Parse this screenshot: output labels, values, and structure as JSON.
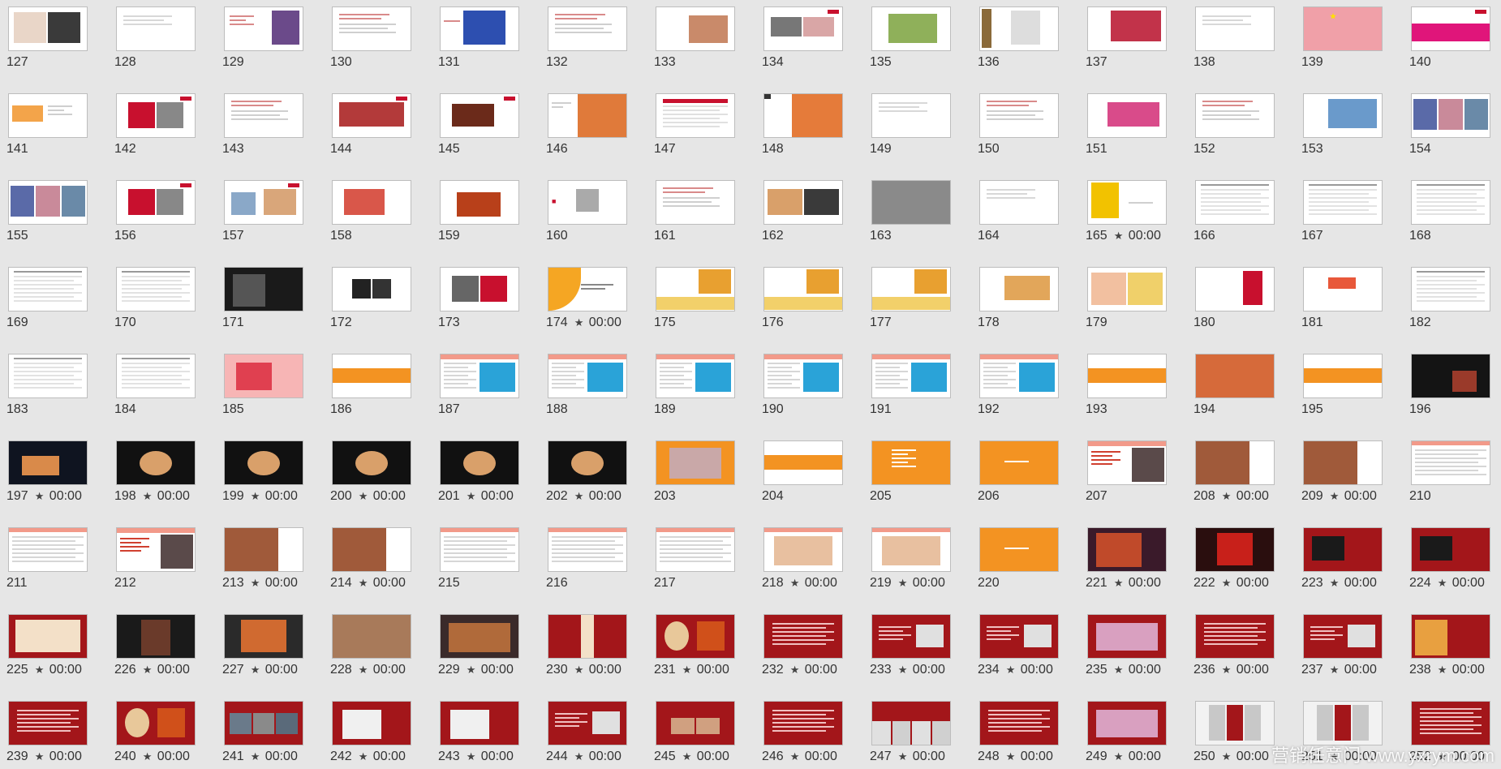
{
  "slides": [
    {
      "n": "127",
      "t": "",
      "s": "w1"
    },
    {
      "n": "128",
      "t": "",
      "s": "w0"
    },
    {
      "n": "129",
      "t": "",
      "s": "w4"
    },
    {
      "n": "130",
      "t": "",
      "s": "w2"
    },
    {
      "n": "131",
      "t": "",
      "s": "w5"
    },
    {
      "n": "132",
      "t": "",
      "s": "w2"
    },
    {
      "n": "133",
      "t": "",
      "s": "w6"
    },
    {
      "n": "134",
      "t": "",
      "s": "w3"
    },
    {
      "n": "135",
      "t": "",
      "s": "w7"
    },
    {
      "n": "136",
      "t": "",
      "s": "w8"
    },
    {
      "n": "137",
      "t": "",
      "s": "w9"
    },
    {
      "n": "138",
      "t": "",
      "s": "w0"
    },
    {
      "n": "139",
      "t": "",
      "s": "w10"
    },
    {
      "n": "140",
      "t": "",
      "s": "w11"
    },
    {
      "n": "141",
      "t": "",
      "s": "w12"
    },
    {
      "n": "142",
      "t": "",
      "s": "w13"
    },
    {
      "n": "143",
      "t": "",
      "s": "w2"
    },
    {
      "n": "144",
      "t": "",
      "s": "w14"
    },
    {
      "n": "145",
      "t": "",
      "s": "w15"
    },
    {
      "n": "146",
      "t": "",
      "s": "w16"
    },
    {
      "n": "147",
      "t": "",
      "s": "w17"
    },
    {
      "n": "148",
      "t": "",
      "s": "w18"
    },
    {
      "n": "149",
      "t": "",
      "s": "w0"
    },
    {
      "n": "150",
      "t": "",
      "s": "w2"
    },
    {
      "n": "151",
      "t": "",
      "s": "w19"
    },
    {
      "n": "152",
      "t": "",
      "s": "w2"
    },
    {
      "n": "153",
      "t": "",
      "s": "w20"
    },
    {
      "n": "154",
      "t": "",
      "s": "w21"
    },
    {
      "n": "155",
      "t": "",
      "s": "w21"
    },
    {
      "n": "156",
      "t": "",
      "s": "w13"
    },
    {
      "n": "157",
      "t": "",
      "s": "w22"
    },
    {
      "n": "158",
      "t": "",
      "s": "w23"
    },
    {
      "n": "159",
      "t": "",
      "s": "w24"
    },
    {
      "n": "160",
      "t": "",
      "s": "w25"
    },
    {
      "n": "161",
      "t": "",
      "s": "w2"
    },
    {
      "n": "162",
      "t": "",
      "s": "w26"
    },
    {
      "n": "163",
      "t": "",
      "s": "w27"
    },
    {
      "n": "164",
      "t": "",
      "s": "w0"
    },
    {
      "n": "165",
      "t": "00:00",
      "s": "w28"
    },
    {
      "n": "166",
      "t": "",
      "s": "w29"
    },
    {
      "n": "167",
      "t": "",
      "s": "w29"
    },
    {
      "n": "168",
      "t": "",
      "s": "w29"
    },
    {
      "n": "169",
      "t": "",
      "s": "w29"
    },
    {
      "n": "170",
      "t": "",
      "s": "w29"
    },
    {
      "n": "171",
      "t": "",
      "s": "d1"
    },
    {
      "n": "172",
      "t": "",
      "s": "w30"
    },
    {
      "n": "173",
      "t": "",
      "s": "w31"
    },
    {
      "n": "174",
      "t": "00:00",
      "s": "w32"
    },
    {
      "n": "175",
      "t": "",
      "s": "w33"
    },
    {
      "n": "176",
      "t": "",
      "s": "w33"
    },
    {
      "n": "177",
      "t": "",
      "s": "w33"
    },
    {
      "n": "178",
      "t": "",
      "s": "w34"
    },
    {
      "n": "179",
      "t": "",
      "s": "w35"
    },
    {
      "n": "180",
      "t": "",
      "s": "w36"
    },
    {
      "n": "181",
      "t": "",
      "s": "w37"
    },
    {
      "n": "182",
      "t": "",
      "s": "w29"
    },
    {
      "n": "183",
      "t": "",
      "s": "w29"
    },
    {
      "n": "184",
      "t": "",
      "s": "w29"
    },
    {
      "n": "185",
      "t": "",
      "s": "w38"
    },
    {
      "n": "186",
      "t": "",
      "s": "o1"
    },
    {
      "n": "187",
      "t": "",
      "s": "w39"
    },
    {
      "n": "188",
      "t": "",
      "s": "w39"
    },
    {
      "n": "189",
      "t": "",
      "s": "w39"
    },
    {
      "n": "190",
      "t": "",
      "s": "w39"
    },
    {
      "n": "191",
      "t": "",
      "s": "w39"
    },
    {
      "n": "192",
      "t": "",
      "s": "w39"
    },
    {
      "n": "193",
      "t": "",
      "s": "o1"
    },
    {
      "n": "194",
      "t": "",
      "s": "w40"
    },
    {
      "n": "195",
      "t": "",
      "s": "o1"
    },
    {
      "n": "196",
      "t": "",
      "s": "d2"
    },
    {
      "n": "197",
      "t": "00:00",
      "s": "d3"
    },
    {
      "n": "198",
      "t": "00:00",
      "s": "d4"
    },
    {
      "n": "199",
      "t": "00:00",
      "s": "d4"
    },
    {
      "n": "200",
      "t": "00:00",
      "s": "d4"
    },
    {
      "n": "201",
      "t": "00:00",
      "s": "d4"
    },
    {
      "n": "202",
      "t": "00:00",
      "s": "d4"
    },
    {
      "n": "203",
      "t": "",
      "s": "o2"
    },
    {
      "n": "204",
      "t": "",
      "s": "o1"
    },
    {
      "n": "205",
      "t": "",
      "s": "o3"
    },
    {
      "n": "206",
      "t": "",
      "s": "o4"
    },
    {
      "n": "207",
      "t": "",
      "s": "w41"
    },
    {
      "n": "208",
      "t": "00:00",
      "s": "w42"
    },
    {
      "n": "209",
      "t": "00:00",
      "s": "w42"
    },
    {
      "n": "210",
      "t": "",
      "s": "w43"
    },
    {
      "n": "211",
      "t": "",
      "s": "w43"
    },
    {
      "n": "212",
      "t": "",
      "s": "w41"
    },
    {
      "n": "213",
      "t": "00:00",
      "s": "w42"
    },
    {
      "n": "214",
      "t": "00:00",
      "s": "w42"
    },
    {
      "n": "215",
      "t": "",
      "s": "w43"
    },
    {
      "n": "216",
      "t": "",
      "s": "w43"
    },
    {
      "n": "217",
      "t": "",
      "s": "w43"
    },
    {
      "n": "218",
      "t": "00:00",
      "s": "w44"
    },
    {
      "n": "219",
      "t": "00:00",
      "s": "w44"
    },
    {
      "n": "220",
      "t": "",
      "s": "o4"
    },
    {
      "n": "221",
      "t": "00:00",
      "s": "d5"
    },
    {
      "n": "222",
      "t": "00:00",
      "s": "d6"
    },
    {
      "n": "223",
      "t": "00:00",
      "s": "r1"
    },
    {
      "n": "224",
      "t": "00:00",
      "s": "r1"
    },
    {
      "n": "225",
      "t": "00:00",
      "s": "r2"
    },
    {
      "n": "226",
      "t": "00:00",
      "s": "d7"
    },
    {
      "n": "227",
      "t": "00:00",
      "s": "d8"
    },
    {
      "n": "228",
      "t": "00:00",
      "s": "w45"
    },
    {
      "n": "229",
      "t": "00:00",
      "s": "d9"
    },
    {
      "n": "230",
      "t": "00:00",
      "s": "r3"
    },
    {
      "n": "231",
      "t": "00:00",
      "s": "r4"
    },
    {
      "n": "232",
      "t": "00:00",
      "s": "r5"
    },
    {
      "n": "233",
      "t": "00:00",
      "s": "r6"
    },
    {
      "n": "234",
      "t": "00:00",
      "s": "r6"
    },
    {
      "n": "235",
      "t": "00:00",
      "s": "r7"
    },
    {
      "n": "236",
      "t": "00:00",
      "s": "r5"
    },
    {
      "n": "237",
      "t": "00:00",
      "s": "r6"
    },
    {
      "n": "238",
      "t": "00:00",
      "s": "r8"
    },
    {
      "n": "239",
      "t": "00:00",
      "s": "r5"
    },
    {
      "n": "240",
      "t": "00:00",
      "s": "r4"
    },
    {
      "n": "241",
      "t": "00:00",
      "s": "r9"
    },
    {
      "n": "242",
      "t": "00:00",
      "s": "r10"
    },
    {
      "n": "243",
      "t": "00:00",
      "s": "r10"
    },
    {
      "n": "244",
      "t": "00:00",
      "s": "r6"
    },
    {
      "n": "245",
      "t": "00:00",
      "s": "r11"
    },
    {
      "n": "246",
      "t": "00:00",
      "s": "r5"
    },
    {
      "n": "247",
      "t": "00:00",
      "s": "r12"
    },
    {
      "n": "248",
      "t": "00:00",
      "s": "r5"
    },
    {
      "n": "249",
      "t": "00:00",
      "s": "r7"
    },
    {
      "n": "250",
      "t": "00:00",
      "s": "r13"
    },
    {
      "n": "251",
      "t": "00:00",
      "s": "r13"
    },
    {
      "n": "252",
      "t": "00:00",
      "s": "r14"
    }
  ],
  "star_glyph": "★",
  "watermark": "营销任意门 www.yxrym.com",
  "colors": {
    "background": "#e6e6e6",
    "brand_red": "#c8102e",
    "orange": "#f39322"
  }
}
